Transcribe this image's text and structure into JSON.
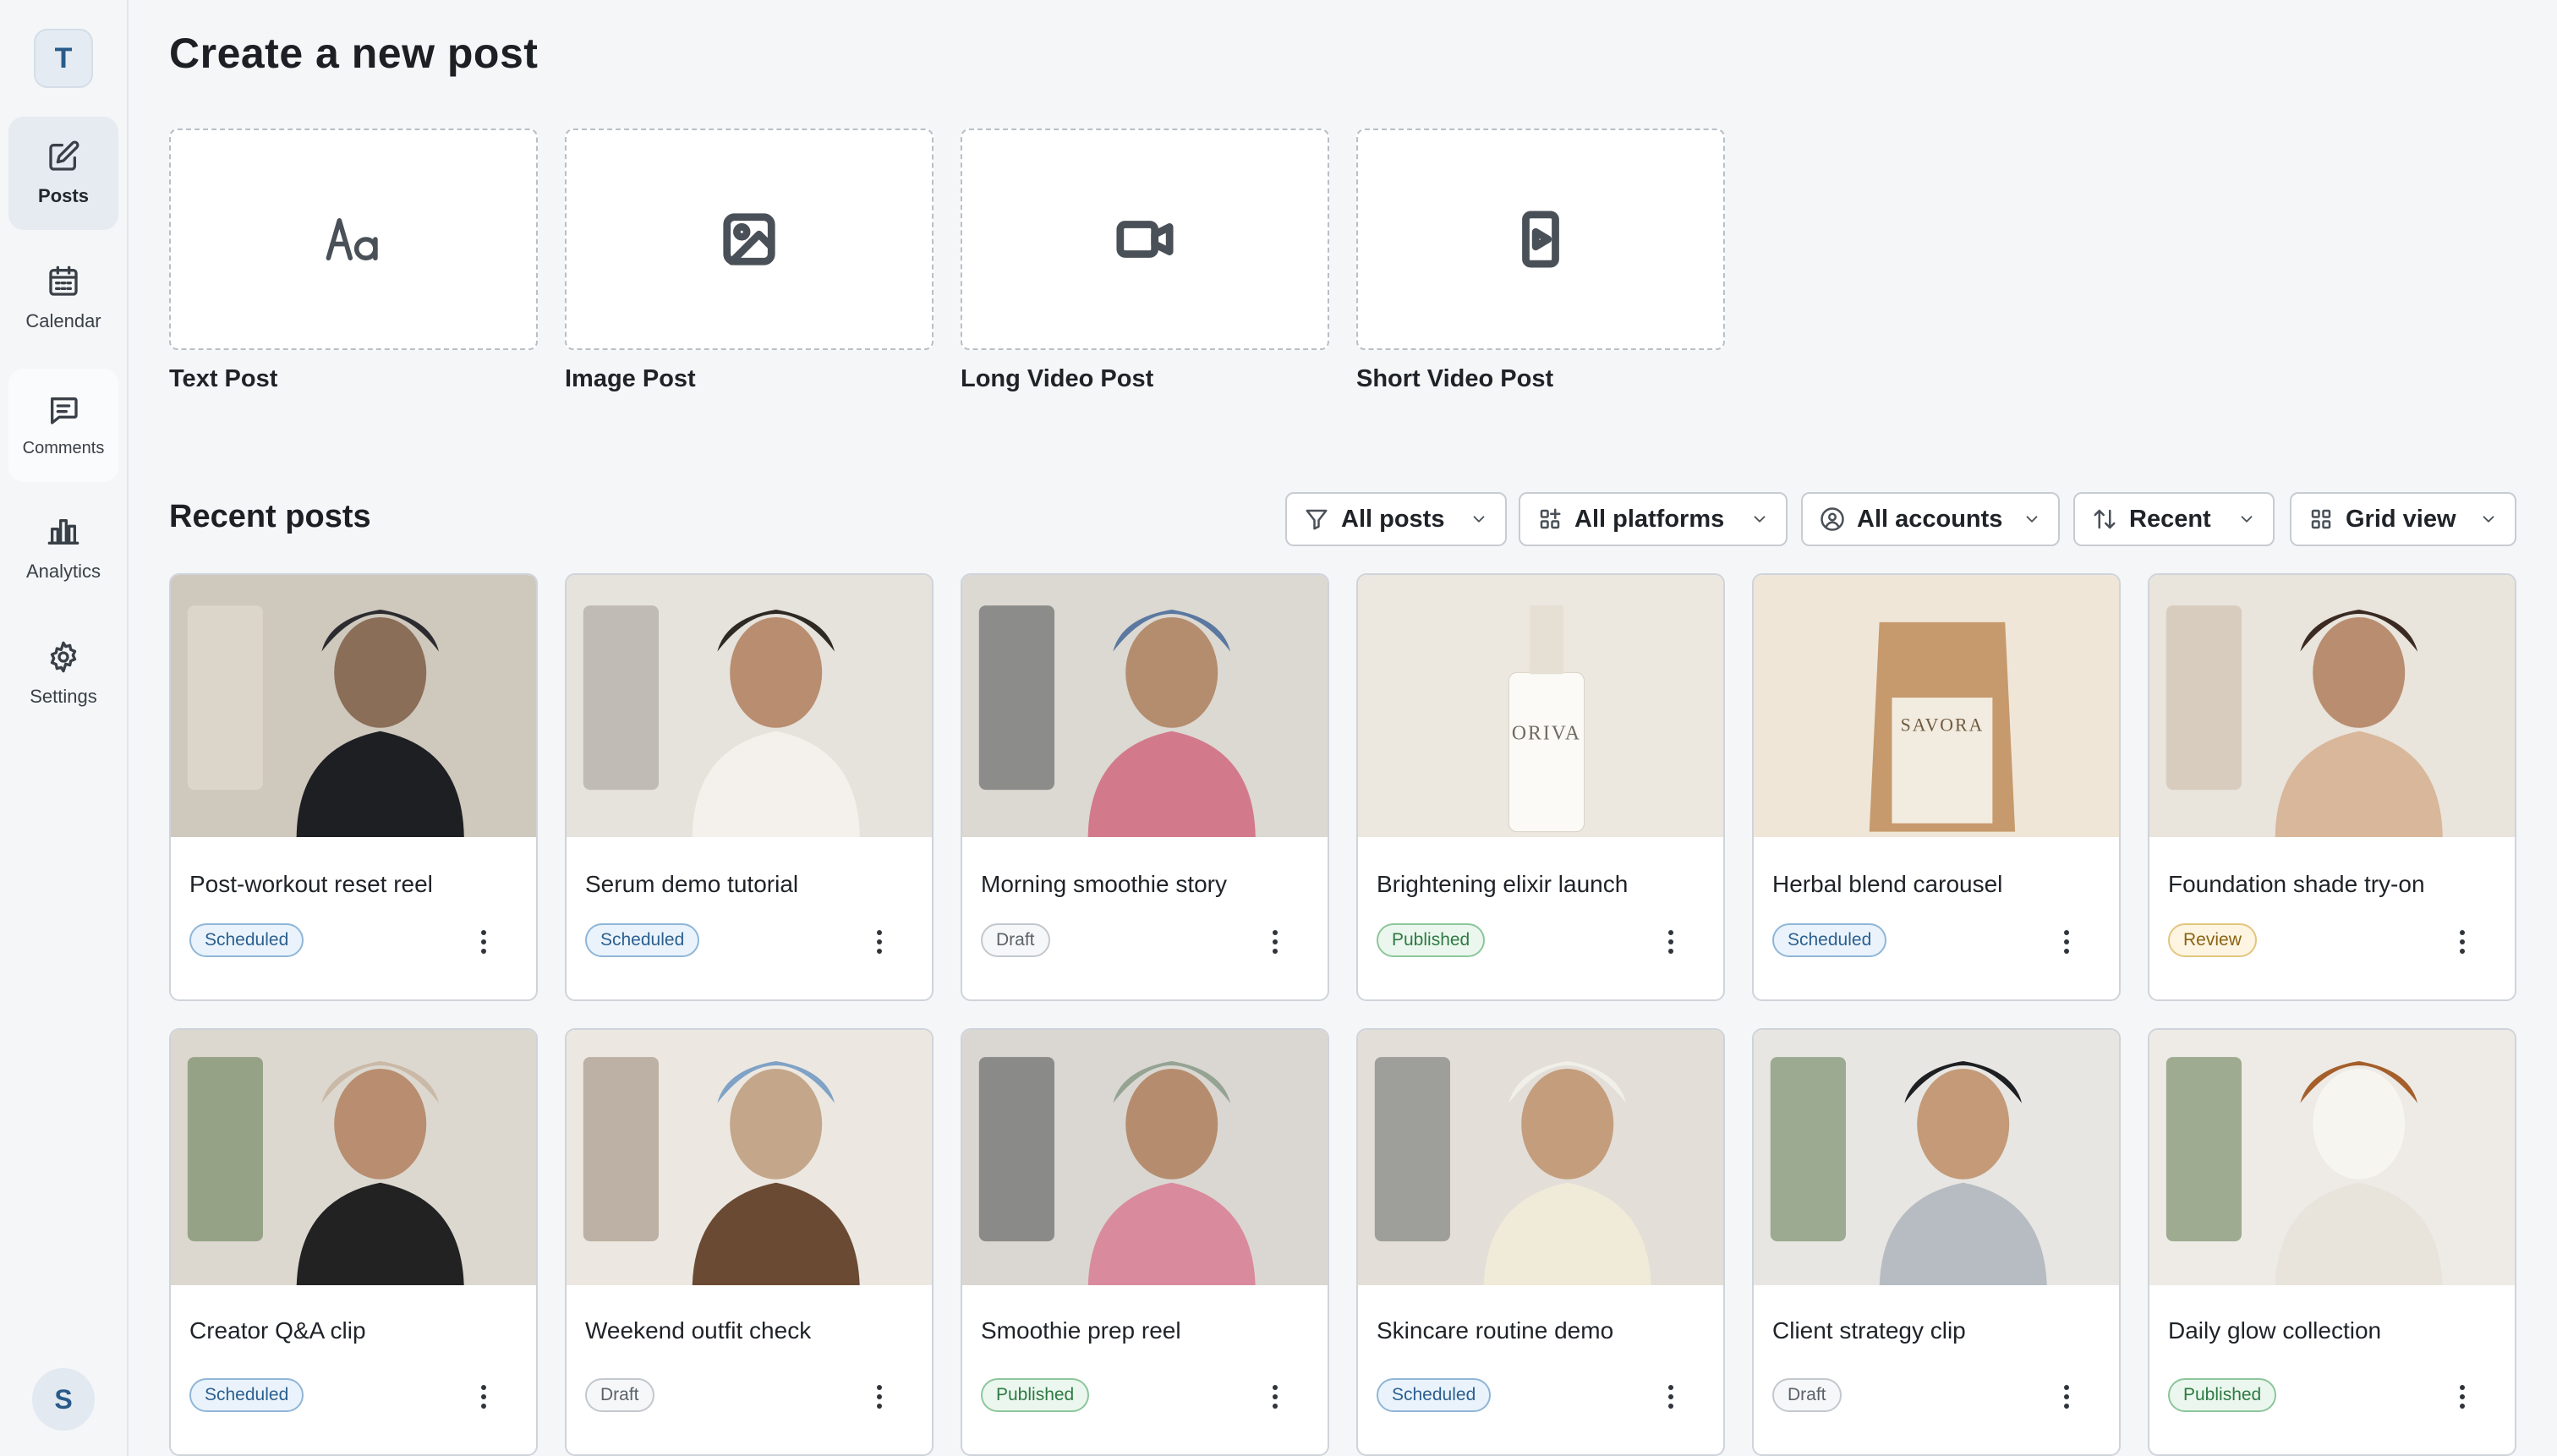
{
  "sidebar": {
    "workspace_initial": "T",
    "items": [
      {
        "label": "Posts",
        "icon": "edit-icon",
        "active": true
      },
      {
        "label": "Calendar",
        "icon": "calendar-icon",
        "active": false
      },
      {
        "label": "Comments",
        "icon": "comment-icon",
        "active": false
      },
      {
        "label": "Analytics",
        "icon": "bar-chart-icon",
        "active": false
      },
      {
        "label": "Settings",
        "icon": "gear-icon",
        "active": false
      }
    ],
    "user_initial": "S"
  },
  "create": {
    "title": "Create a new post",
    "options": [
      {
        "label": "Text Post",
        "icon": "text-icon"
      },
      {
        "label": "Image Post",
        "icon": "image-icon"
      },
      {
        "label": "Long Video Post",
        "icon": "video-camera-icon"
      },
      {
        "label": "Short Video Post",
        "icon": "short-video-icon"
      }
    ]
  },
  "recent": {
    "title": "Recent posts",
    "filters": [
      {
        "label": "All posts",
        "icon": "filter-icon"
      },
      {
        "label": "All platforms",
        "icon": "grid-apps-icon"
      },
      {
        "label": "All accounts",
        "icon": "user-circle-icon"
      },
      {
        "label": "Recent",
        "icon": "sort-icon"
      },
      {
        "label": "Grid view",
        "icon": "grid-icon"
      }
    ],
    "posts": [
      {
        "title": "Post-workout reset reel",
        "status": "Scheduled"
      },
      {
        "title": "Serum demo tutorial",
        "status": "Scheduled"
      },
      {
        "title": "Morning smoothie story",
        "status": "Draft"
      },
      {
        "title": "Brightening elixir launch",
        "status": "Published"
      },
      {
        "title": "Herbal blend carousel",
        "status": "Scheduled"
      },
      {
        "title": "Foundation shade try-on",
        "status": "Review"
      },
      {
        "title": "Creator Q&A clip",
        "status": "Scheduled"
      },
      {
        "title": "Weekend outfit check",
        "status": "Draft"
      },
      {
        "title": "Smoothie prep reel",
        "status": "Published"
      },
      {
        "title": "Skincare routine demo",
        "status": "Scheduled"
      },
      {
        "title": "Client strategy clip",
        "status": "Draft"
      },
      {
        "title": "Daily glow collection",
        "status": "Published"
      }
    ],
    "thumb_labels": {
      "oriva": "ORIVA",
      "savora": "SAVORA"
    }
  },
  "colors": {
    "accent": "#2a5a8a",
    "scheduled": "#2b5f8f",
    "published": "#2e7a43",
    "review": "#8a6313",
    "draft": "#5b626a"
  }
}
